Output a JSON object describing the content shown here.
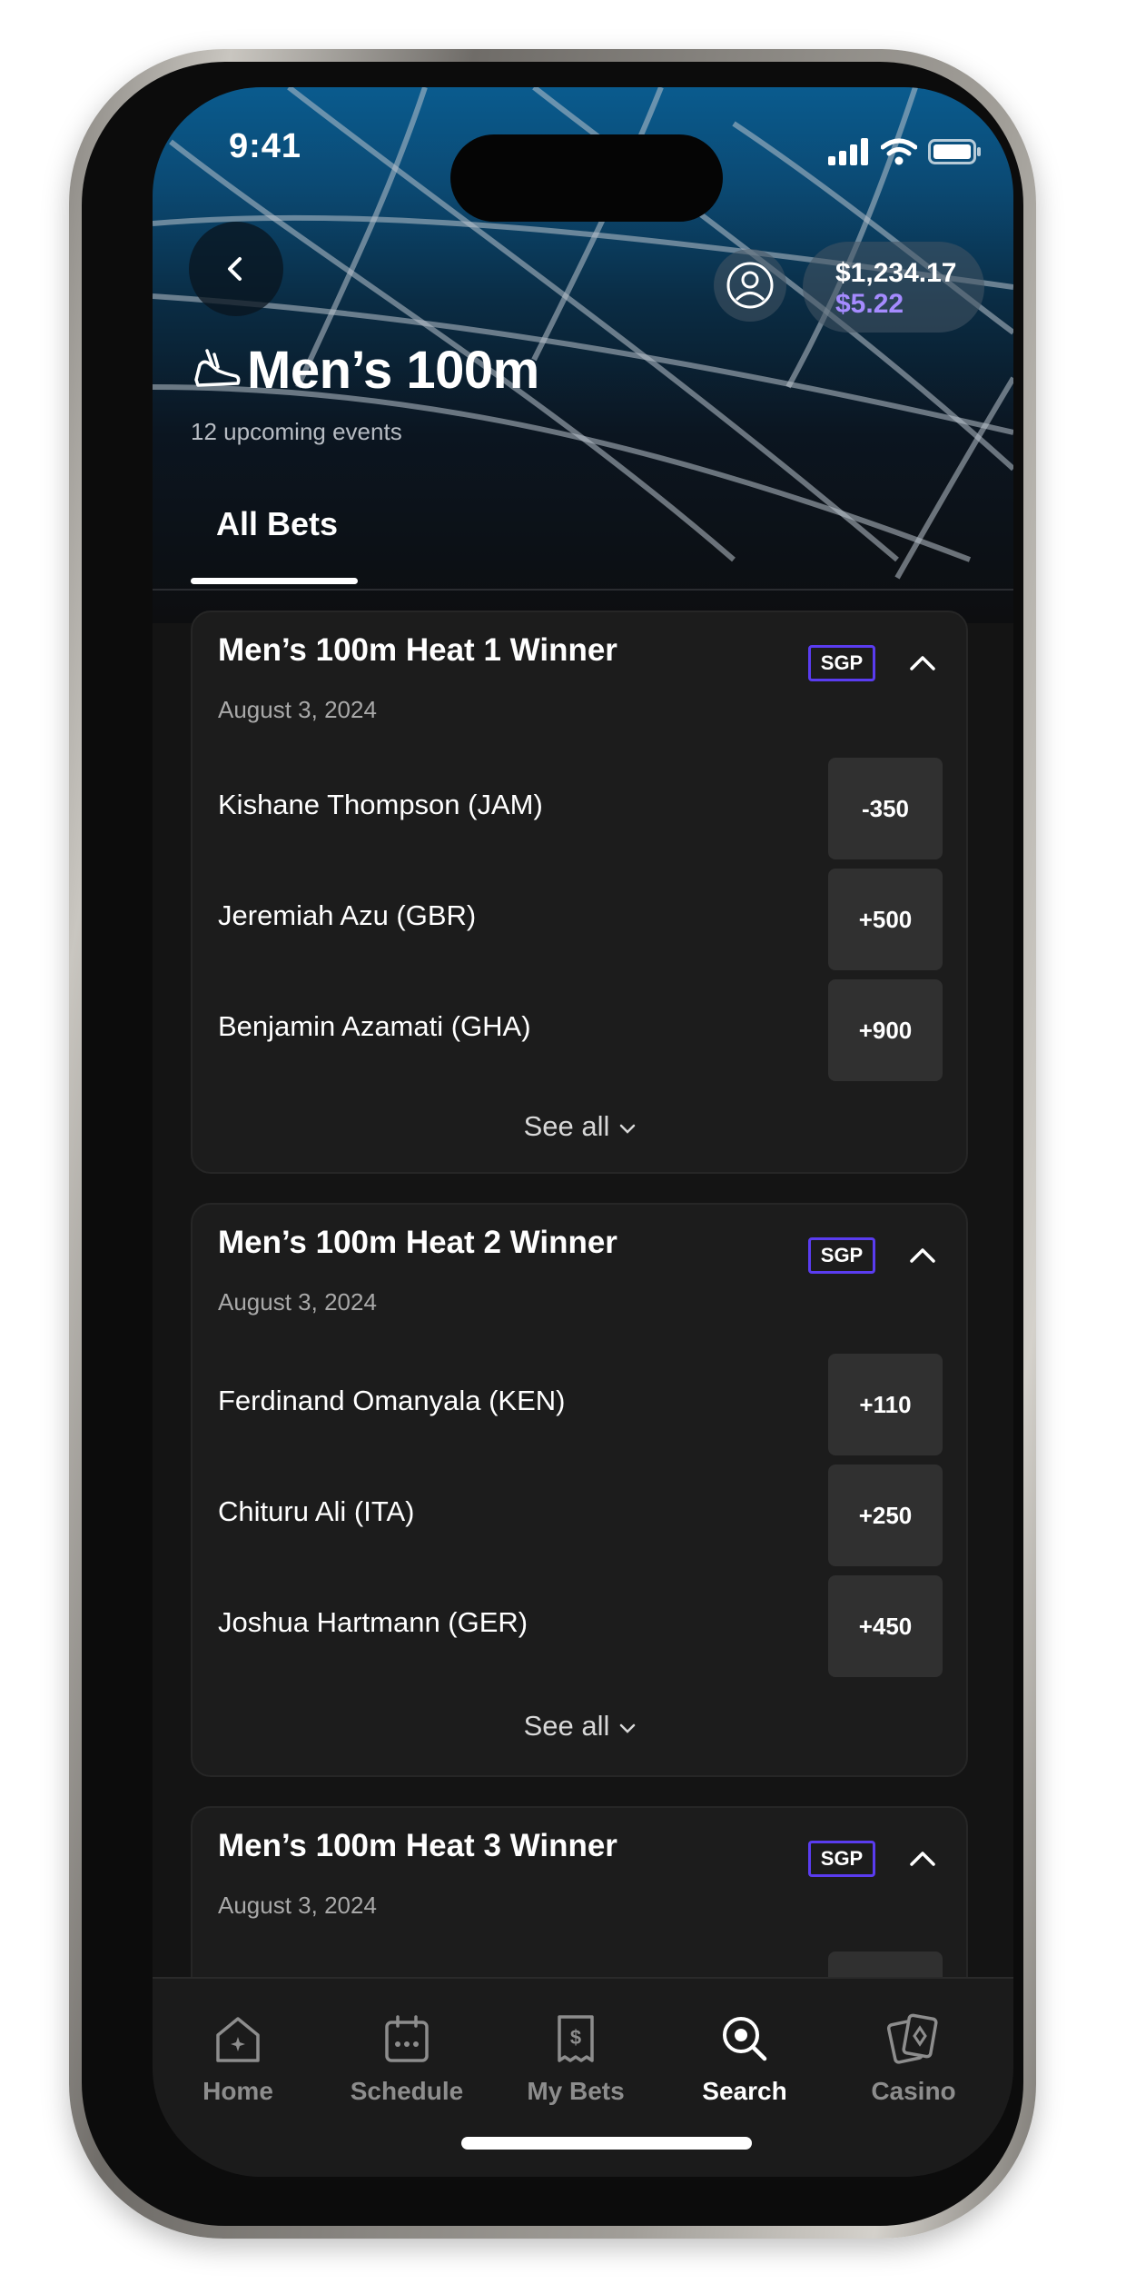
{
  "status_bar": {
    "time": "9:41"
  },
  "header": {
    "title": "Men’s 100m",
    "subtitle": "12 upcoming events",
    "balance": "$1,234.17",
    "bonus_balance": "$5.22"
  },
  "tabs": [
    {
      "label": "All Bets",
      "active": true
    }
  ],
  "markets": [
    {
      "title": "Men’s 100m Heat 1 Winner",
      "date": "August 3, 2024",
      "badge": "SGP",
      "selections": [
        {
          "name": "Kishane Thompson (JAM)",
          "odds": "-350"
        },
        {
          "name": "Jeremiah Azu (GBR)",
          "odds": "+500"
        },
        {
          "name": "Benjamin Azamati (GHA)",
          "odds": "+900"
        }
      ],
      "see_all": "See all"
    },
    {
      "title": "Men’s 100m Heat 2 Winner",
      "date": "August 3, 2024",
      "badge": "SGP",
      "selections": [
        {
          "name": "Ferdinand Omanyala (KEN)",
          "odds": "+110"
        },
        {
          "name": "Chituru Ali (ITA)",
          "odds": "+250"
        },
        {
          "name": "Joshua Hartmann (GER)",
          "odds": "+450"
        }
      ],
      "see_all": "See all"
    },
    {
      "title": "Men’s 100m Heat 3 Winner",
      "date": "August 3, 2024",
      "badge": "SGP",
      "selections": [],
      "see_all": ""
    }
  ],
  "bottom_nav": [
    {
      "label": "Home",
      "icon": "home-icon",
      "active": false
    },
    {
      "label": "Schedule",
      "icon": "calendar-icon",
      "active": false
    },
    {
      "label": "My Bets",
      "icon": "bet-slip-icon",
      "active": false
    },
    {
      "label": "Search",
      "icon": "search-icon",
      "active": true
    },
    {
      "label": "Casino",
      "icon": "cards-icon",
      "active": false
    }
  ],
  "colors": {
    "accent_purple": "#5a3cf0",
    "bonus_text": "#a58bff",
    "card_background": "#1c1c1c",
    "odds_button": "#303030"
  }
}
